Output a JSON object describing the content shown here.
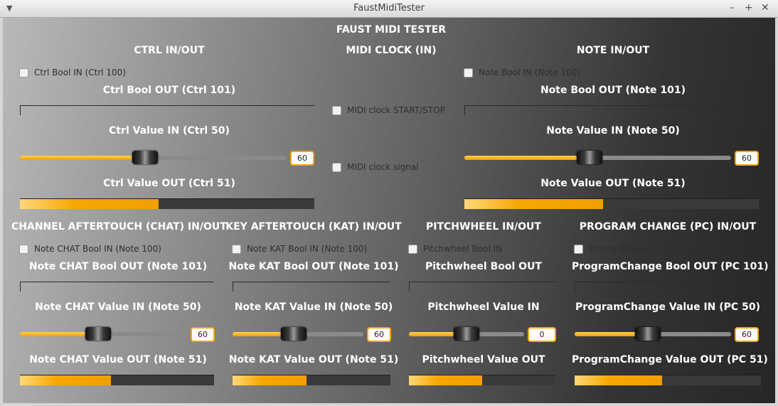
{
  "window": {
    "title": "FaustMidiTester"
  },
  "main_title": "FAUST MIDI TESTER",
  "ctrl": {
    "header": "CTRL IN/OUT",
    "bool_in": "Ctrl Bool IN (Ctrl 100)",
    "bool_out": "Ctrl Bool OUT (Ctrl 101)",
    "value_in": "Ctrl Value IN (Ctrl 50)",
    "value_in_val": "60",
    "value_in_frac": 0.47,
    "value_out": "Ctrl Value OUT (Ctrl 51)",
    "value_out_frac": 0.47
  },
  "clock": {
    "header": "MIDI CLOCK (IN)",
    "start_stop": "MIDI clock START/STOP",
    "signal": "MIDI clock signal"
  },
  "note": {
    "header": "NOTE IN/OUT",
    "bool_in": "Note Bool IN (Note 100)",
    "bool_out": "Note Bool OUT (Note 101)",
    "value_in": "Note Value IN (Note 50)",
    "value_in_val": "60",
    "value_in_frac": 0.47,
    "value_out": "Note Value OUT (Note 51)",
    "value_out_frac": 0.47
  },
  "chat": {
    "header": "CHANNEL AFTERTOUCH (CHAT) IN/OUT",
    "bool_in": "Note CHAT Bool IN (Note 100)",
    "bool_out": "Note CHAT Bool OUT (Note 101)",
    "value_in": "Note CHAT Value IN (Note 50)",
    "value_in_val": "60",
    "value_in_frac": 0.47,
    "value_out": "Note CHAT Value OUT (Note 51)",
    "value_out_frac": 0.47
  },
  "kat": {
    "header": "KEY AFTERTOUCH (KAT) IN/OUT",
    "bool_in": "Note KAT Bool IN (Note 100)",
    "bool_out": "Note KAT Bool OUT (Note 101)",
    "value_in": "Note KAT Value IN (Note 50)",
    "value_in_val": "60",
    "value_in_frac": 0.47,
    "value_out": "Note KAT Value OUT (Note 51)",
    "value_out_frac": 0.47
  },
  "pitch": {
    "header": "PITCHWHEEL IN/OUT",
    "bool_in": "Pitchwheel Bool IN",
    "bool_out": "Pitchwheel Bool OUT",
    "value_in": "Pitchwheel Value IN",
    "value_in_val": "0",
    "value_in_frac": 0.5,
    "value_out": "Pitchwheel Value OUT",
    "value_out_frac": 0.5
  },
  "pc": {
    "header": "PROGRAM CHANGE (PC) IN/OUT",
    "bool_in": "ProgramChange Bool IN (PC 100)",
    "bool_out": "ProgramChange Bool OUT (PC 101)",
    "value_in": "ProgramChange Value IN (PC 50)",
    "value_in_val": "60",
    "value_in_frac": 0.47,
    "value_out": "ProgramChange Value OUT (PC 51)",
    "value_out_frac": 0.47
  },
  "icons": {
    "menu": "chevron-down-icon",
    "minimize": "minimize-icon",
    "maximize": "maximize-icon",
    "close": "close-icon"
  }
}
